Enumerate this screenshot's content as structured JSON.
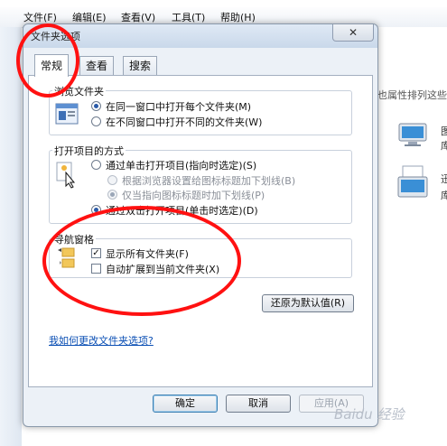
{
  "background": {
    "menu": [
      "文件(F)",
      "编辑(E)",
      "查看(V)",
      "工具(T)",
      "帮助(H)"
    ],
    "right_text": "也属性排列这些",
    "right_glyphs": [
      "图",
      "库",
      "迅",
      "库"
    ]
  },
  "dialog": {
    "title": "文件夹选项",
    "close_glyph": "✕",
    "tabs": [
      "常规",
      "查看",
      "搜索"
    ],
    "browse_group": {
      "label": "浏览文件夹",
      "options": [
        "在同一窗口中打开每个文件夹(M)",
        "在不同窗口中打开不同的文件夹(W)"
      ],
      "selected": 0
    },
    "open_items_group": {
      "label": "打开项目的方式",
      "single_click": "通过单击打开项目(指向时选定)(S)",
      "underline_browser": "根据浏览器设置给图标标题加下划线(B)",
      "underline_hover": "仅当指向图标标题时加下划线(P)",
      "double_click": "通过双击打开项目(单击时选定)(D)"
    },
    "nav_group": {
      "label": "导航窗格",
      "show_all": "显示所有文件夹(F)",
      "show_all_check": "✓",
      "auto_expand": "自动扩展到当前文件夹(X)"
    },
    "restore_button": "还原为默认值(R)",
    "help_link": "我如何更改文件夹选项?",
    "ok_button": "确定",
    "cancel_button": "取消",
    "apply_button": "应用(A)"
  },
  "colors": {
    "annotation": "#ff1111",
    "link": "#0b4fb4"
  },
  "watermark": "Baidu 经验"
}
